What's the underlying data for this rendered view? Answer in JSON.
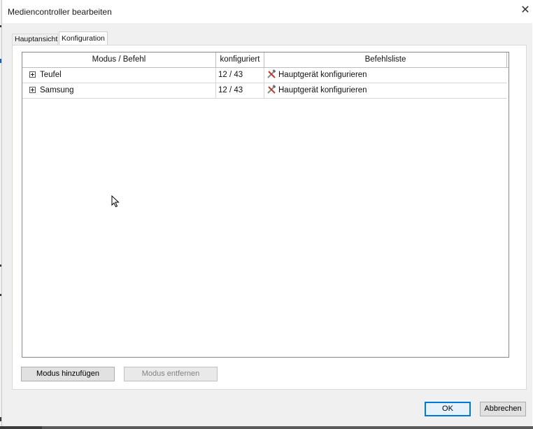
{
  "window": {
    "title": "Mediencontroller bearbeiten",
    "close_glyph": "✕"
  },
  "tabs": [
    {
      "label": "Hauptansicht",
      "selected": false
    },
    {
      "label": "Konfiguration",
      "selected": true
    }
  ],
  "grid": {
    "columns": [
      "Modus / Befehl",
      "konfiguriert",
      "Befehlsliste"
    ],
    "rows": [
      {
        "name": "Teufel",
        "configured": "12 / 43",
        "command": "Hauptgerät konfigurieren",
        "icon": "tools-icon"
      },
      {
        "name": "Samsung",
        "configured": "12 / 43",
        "command": "Hauptgerät konfigurieren",
        "icon": "tools-icon"
      }
    ]
  },
  "buttons": {
    "add_mode": "Modus hinzufügen",
    "remove_mode": "Modus entfernen",
    "ok": "OK",
    "cancel": "Abbrechen"
  },
  "colors": {
    "dialog_bg": "#f0f0f0",
    "panel_bg": "#ffffff",
    "ok_border": "#0078d7",
    "disabled_text": "#838383"
  }
}
